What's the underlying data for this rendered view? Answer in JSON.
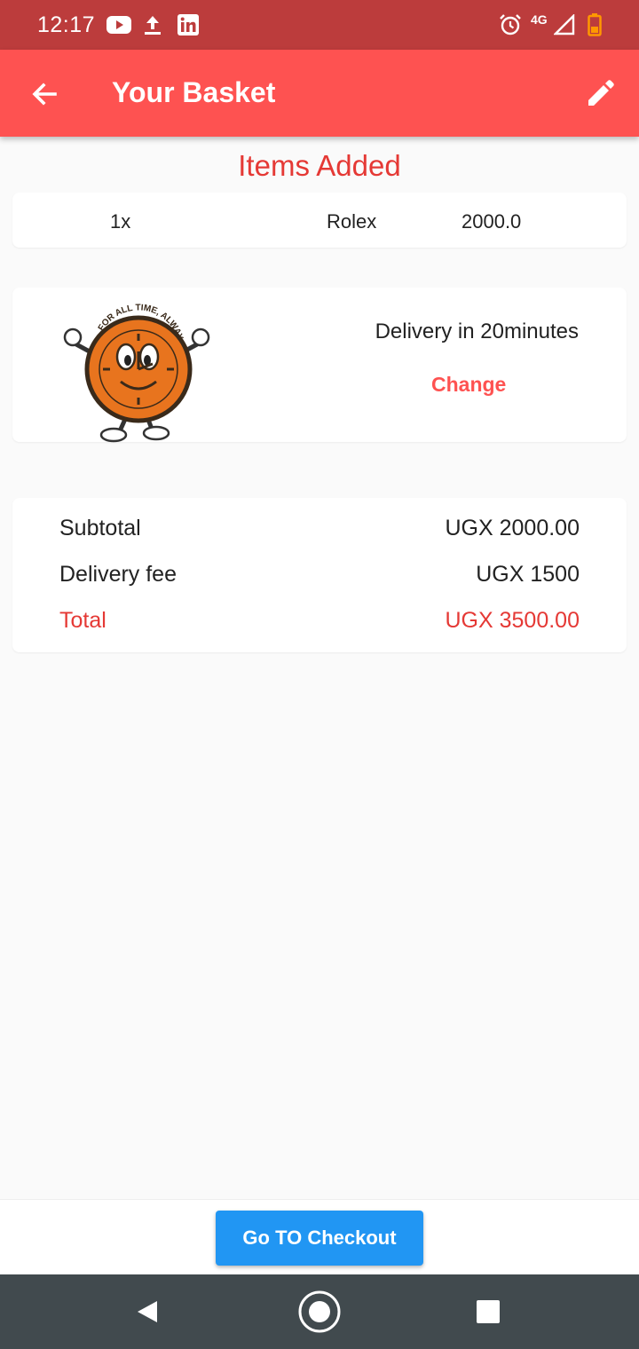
{
  "status_bar": {
    "time": "12:17",
    "network": "4G",
    "icons": [
      "youtube-icon",
      "upload-icon",
      "linkedin-icon",
      "alarm-icon",
      "signal-icon",
      "battery-icon"
    ]
  },
  "app_bar": {
    "title": "Your Basket",
    "back_icon": "arrow-back-icon",
    "edit_icon": "pencil-icon",
    "color": "#fe5251"
  },
  "items_section": {
    "title": "Items Added",
    "items": [
      {
        "quantity": "1x",
        "name": "Rolex",
        "price": "2000.0"
      }
    ]
  },
  "delivery": {
    "mascot_text": "FOR ALL TIME, ALWAYS",
    "text": "Delivery in 20minutes",
    "change_label": "Change"
  },
  "summary": {
    "subtotal_label": "Subtotal",
    "subtotal_value": "UGX 2000.00",
    "fee_label": "Delivery fee",
    "fee_value": "UGX 1500",
    "total_label": "Total",
    "total_value": "UGX 3500.00",
    "total_color": "#e53935"
  },
  "checkout": {
    "label": "Go TO Checkout",
    "color": "#2196f3"
  },
  "nav": {
    "icons": [
      "nav-back-icon",
      "nav-home-icon",
      "nav-recent-icon"
    ]
  }
}
